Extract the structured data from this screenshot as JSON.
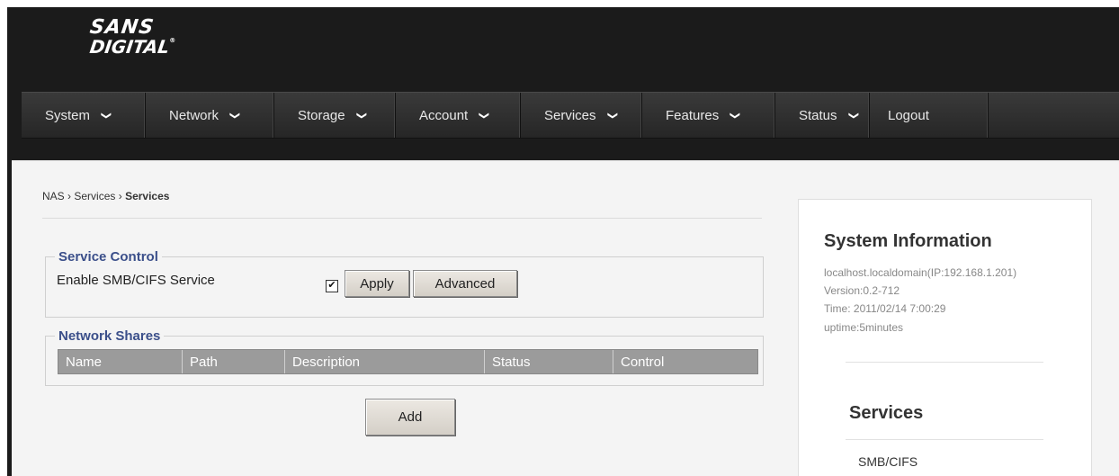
{
  "logo": {
    "line1": "SANS",
    "line2": "DIGITAL",
    "mark": "®"
  },
  "nav": [
    {
      "label": "System",
      "chevron": "❯"
    },
    {
      "label": "Network",
      "chevron": "❯"
    },
    {
      "label": "Storage",
      "chevron": "❯"
    },
    {
      "label": "Account",
      "chevron": "❯"
    },
    {
      "label": "Services",
      "chevron": "❯"
    },
    {
      "label": "Features",
      "chevron": "❯"
    },
    {
      "label": "Status",
      "chevron": "❯"
    },
    {
      "label": "Logout"
    }
  ],
  "breadcrumb": {
    "root": "NAS",
    "sep": "›",
    "section": "Services",
    "current": "Services"
  },
  "service_control": {
    "legend": "Service Control",
    "label": "Enable SMB/CIFS Service",
    "checked_glyph": "✔",
    "apply": "Apply",
    "advanced": "Advanced"
  },
  "network_shares": {
    "legend": "Network Shares",
    "columns": [
      "Name",
      "Path",
      "Description",
      "Status",
      "Control"
    ],
    "add": "Add"
  },
  "system_info": {
    "title": "System Information",
    "host": "localhost.localdomain(IP:192.168.1.201)",
    "version": "Version:0.2-712",
    "time": "Time: 2011/02/14 7:00:29",
    "uptime": "uptime:5minutes"
  },
  "services_panel": {
    "title": "Services",
    "items": [
      "SMB/CIFS"
    ]
  }
}
